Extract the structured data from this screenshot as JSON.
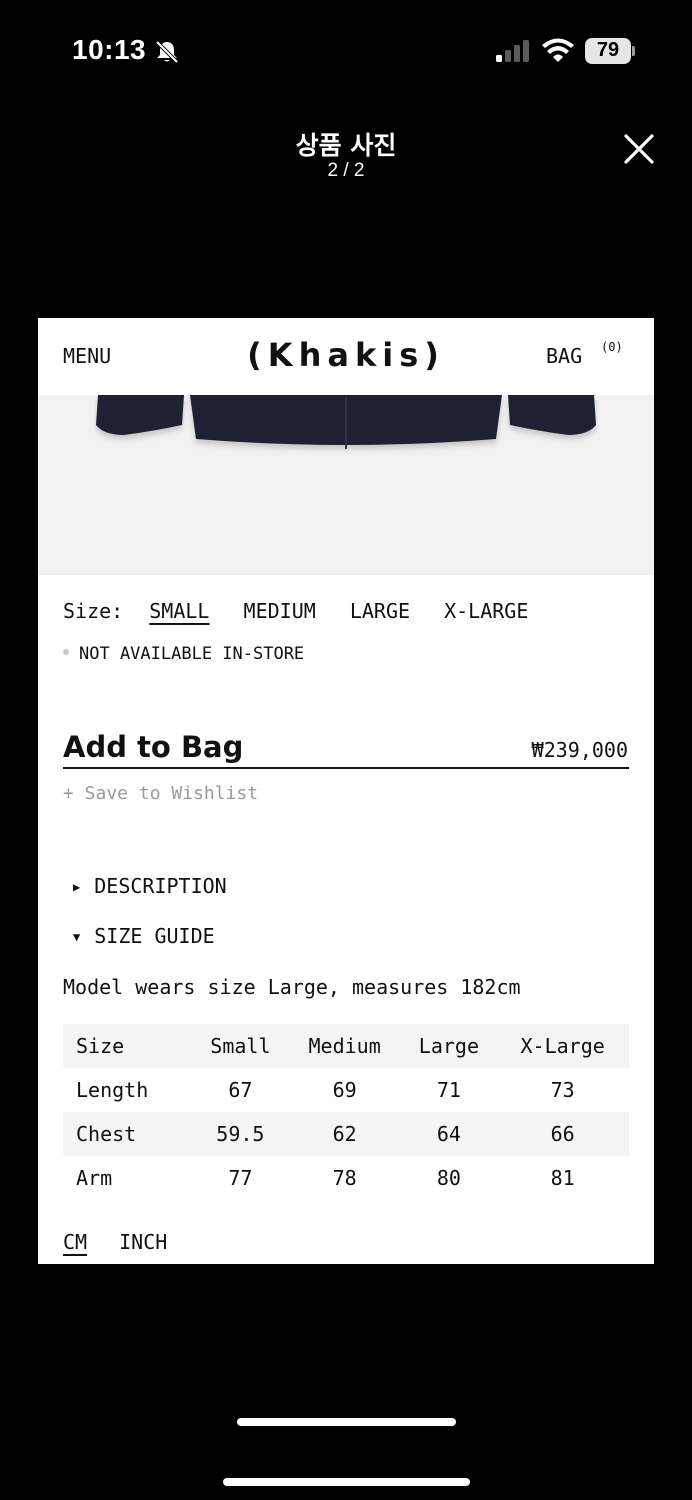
{
  "status_bar": {
    "time": "10:13",
    "battery": "79"
  },
  "viewer": {
    "title": "상품 사진",
    "counter": "2 / 2"
  },
  "card": {
    "menu": "MENU",
    "logo": "(Khakis)",
    "bag": "BAG",
    "bag_count": "(0)",
    "size_label": "Size:",
    "sizes": [
      "SMALL",
      "MEDIUM",
      "LARGE",
      "X-LARGE"
    ],
    "selected_size": "SMALL",
    "availability": "NOT AVAILABLE IN-STORE",
    "add_to_bag": "Add to Bag",
    "price": "₩239,000",
    "wishlist": "+ Save to Wishlist",
    "description": "DESCRIPTION",
    "size_guide": "SIZE GUIDE",
    "model_note": "Model wears size Large, measures 182cm",
    "table": {
      "headers": [
        "Size",
        "Small",
        "Medium",
        "Large",
        "X-Large"
      ],
      "rows": [
        [
          "Length",
          "67",
          "69",
          "71",
          "73"
        ],
        [
          "Chest",
          "59.5",
          "62",
          "64",
          "66"
        ],
        [
          "Arm",
          "77",
          "78",
          "80",
          "81"
        ]
      ]
    },
    "units": [
      "CM",
      "INCH"
    ],
    "selected_unit": "CM"
  },
  "colors": {
    "background": "#000000",
    "card": "#ffffff",
    "text": "#111111",
    "muted": "#9a9a9a",
    "jacket": "#1c2233"
  }
}
